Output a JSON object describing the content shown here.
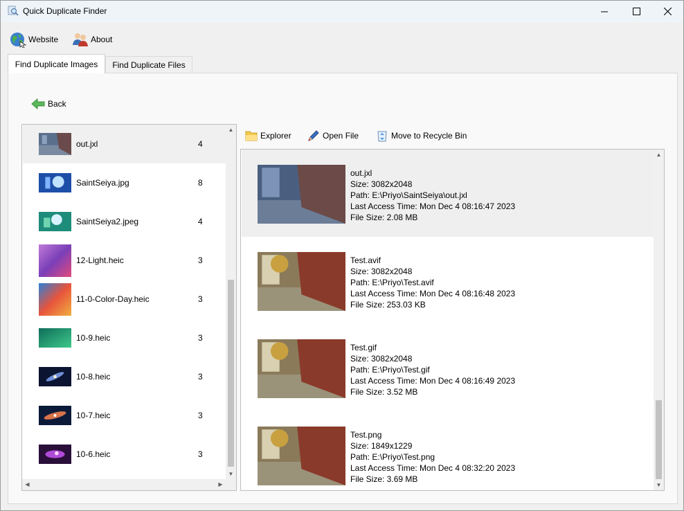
{
  "window": {
    "title": "Quick Duplicate Finder"
  },
  "toolbar": {
    "website_label": "Website",
    "about_label": "About"
  },
  "tabs": [
    {
      "label": "Find Duplicate Images",
      "active": true
    },
    {
      "label": "Find Duplicate Files",
      "active": false
    }
  ],
  "back_label": "Back",
  "groups": [
    {
      "name": "out.jxl",
      "count": "4",
      "thumb": "street"
    },
    {
      "name": "SaintSeiya.jpg",
      "count": "8",
      "thumb": "anime-blue"
    },
    {
      "name": "SaintSeiya2.jpeg",
      "count": "4",
      "thumb": "anime-green"
    },
    {
      "name": "12-Light.heic",
      "count": "3",
      "thumb": "purple-wave"
    },
    {
      "name": "11-0-Color-Day.heic",
      "count": "3",
      "thumb": "red-wave"
    },
    {
      "name": "10-9.heic",
      "count": "3",
      "thumb": "green-wave"
    },
    {
      "name": "10-8.heic",
      "count": "3",
      "thumb": "galaxy"
    },
    {
      "name": "10-7.heic",
      "count": "3",
      "thumb": "nebula-blue"
    },
    {
      "name": "10-6.heic",
      "count": "3",
      "thumb": "nebula-purple"
    }
  ],
  "actions": {
    "explorer_label": "Explorer",
    "open_file_label": "Open File",
    "recycle_label": "Move to Recycle Bin"
  },
  "files": [
    {
      "name": "out.jxl",
      "size": "Size: 3082x2048",
      "path": "Path: E:\\Priyo\\SaintSeiya\\out.jxl",
      "access": "Last Access Time: Mon Dec 4 08:16:47 2023",
      "file_size": "File Size: 2.08 MB",
      "tone": "blue"
    },
    {
      "name": "Test.avif",
      "size": "Size: 3082x2048",
      "path": "Path: E:\\Priyo\\Test.avif",
      "access": "Last Access Time: Mon Dec 4 08:16:48 2023",
      "file_size": "File Size: 253.03 KB",
      "tone": "warm"
    },
    {
      "name": "Test.gif",
      "size": "Size: 3082x2048",
      "path": "Path: E:\\Priyo\\Test.gif",
      "access": "Last Access Time: Mon Dec 4 08:16:49 2023",
      "file_size": "File Size: 3.52 MB",
      "tone": "warm"
    },
    {
      "name": "Test.png",
      "size": "Size: 1849x1229",
      "path": "Path: E:\\Priyo\\Test.png",
      "access": "Last Access Time: Mon Dec 4 08:32:20 2023",
      "file_size": "File Size: 3.69 MB",
      "tone": "warm"
    }
  ]
}
